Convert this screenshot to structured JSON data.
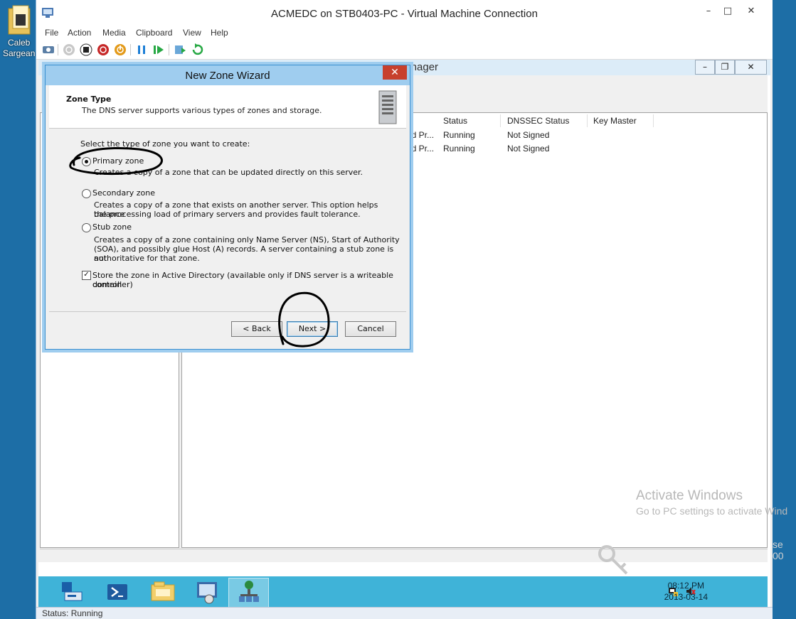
{
  "host_desktop": {
    "icon_label": "Caleb\nSargean",
    "icon_label_line1": "Caleb",
    "icon_label_line2": "Sargean"
  },
  "vm_window": {
    "title": "ACMEDC on STB0403-PC - Virtual Machine Connection",
    "controls": {
      "minimize": "–",
      "maximize": "□",
      "close": "✕"
    },
    "menu": [
      "File",
      "Action",
      "Media",
      "Clipboard",
      "View",
      "Help"
    ],
    "toolbar_icons": [
      "ctrl-alt-del-icon",
      "start-icon",
      "turn-off-icon",
      "shut-down-icon",
      "power-icon",
      "pause-icon",
      "resume-icon",
      "checkpoint-icon",
      "revert-icon"
    ],
    "status": "Status: Running"
  },
  "dns_manager": {
    "title": "DNS Manager",
    "controls": {
      "minimize": "–",
      "restore": "❐",
      "close": "✕"
    },
    "columns": [
      "Status",
      "DNSSEC Status",
      "Key Master"
    ],
    "rows": [
      {
        "partial": "ed Pr...",
        "status": "Running",
        "dnssec": "Not Signed"
      },
      {
        "partial": "ed Pr...",
        "status": "Running",
        "dnssec": "Not Signed"
      }
    ]
  },
  "wizard": {
    "title": "New Zone Wizard",
    "close": "✕",
    "heading": "Zone Type",
    "subheading": "The DNS server supports various types of zones and storage.",
    "prompt": "Select the type of zone you want to create:",
    "options": [
      {
        "label": "Primary zone",
        "description": "Creates a copy of a zone that can be updated directly on this server.",
        "checked": true
      },
      {
        "label": "Secondary zone",
        "description_line1": "Creates a copy of a zone that exists on another server. This option helps balance",
        "description_line2": "the processing load of primary servers and provides fault tolerance.",
        "checked": false
      },
      {
        "label": "Stub zone",
        "description_line1": "Creates a copy of a zone containing only Name Server (NS), Start of Authority",
        "description_line2": "(SOA), and possibly glue Host (A) records. A server containing a stub zone is not",
        "description_line3": "authoritative for that zone.",
        "checked": false
      }
    ],
    "ad_checkbox_line1": "Store the zone in Active Directory (available only if DNS server is a writeable domain",
    "ad_checkbox_line2": "controller)",
    "ad_checked": true,
    "buttons": {
      "back": "< Back",
      "next": "Next >",
      "cancel": "Cancel"
    }
  },
  "taskbar": {
    "apps": [
      "server-manager-icon",
      "powershell-icon",
      "file-explorer-icon",
      "control-panel-icon",
      "dns-manager-icon"
    ],
    "time": "08:12 PM",
    "date": "2013-03-14"
  },
  "watermark": {
    "title": "Activate Windows",
    "subtitle": "Go to PC settings to activate Wind",
    "right_partial_1": "se",
    "right_partial_2": "00"
  },
  "colors": {
    "taskbar": "#3fb3d8",
    "wizard_title": "#9fcdef",
    "close_red": "#c7402d",
    "annotation_ink": "#000000"
  }
}
